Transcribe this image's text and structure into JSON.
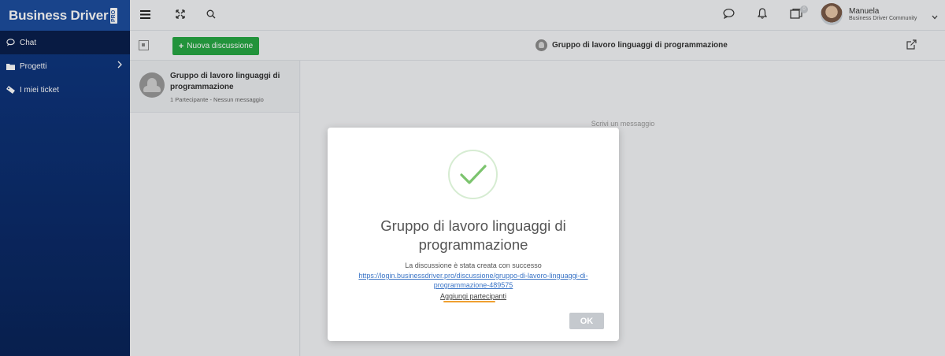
{
  "brand": {
    "name": "Business Driver",
    "tag": "PRO"
  },
  "sidebar": {
    "items": [
      {
        "label": "Chat",
        "icon": "chat-icon"
      },
      {
        "label": "Progetti",
        "icon": "folder-icon"
      },
      {
        "label": "I miei ticket",
        "icon": "ticket-icon"
      }
    ]
  },
  "topbar": {
    "notification_badge": "0",
    "user": {
      "name": "Manuela",
      "org": "Business Driver Community"
    }
  },
  "subbar": {
    "new_button_label": "Nuova discussione",
    "chat_title": "Gruppo di lavoro linguaggi di programmazione"
  },
  "list": {
    "items": [
      {
        "title": "Gruppo di lavoro linguaggi di programmazione",
        "subtitle": "1 Partecipante - Nessun messaggio"
      }
    ]
  },
  "main": {
    "placeholder": "Scrivi un messaggio"
  },
  "modal": {
    "title": "Gruppo di lavoro linguaggi di programmazione",
    "message": "La discussione è stata creata con successo",
    "link": "https://login.businessdriver.pro/discussione/gruppo-di-lavoro-linguaggi-di-programmazione-489575",
    "add_participants": "Aggiungi partecipanti",
    "ok_label": "OK"
  },
  "colors": {
    "sidebar": "#0f3a86",
    "accent_green": "#27a844",
    "check": "#7cc46e",
    "link": "#3a74c6"
  }
}
